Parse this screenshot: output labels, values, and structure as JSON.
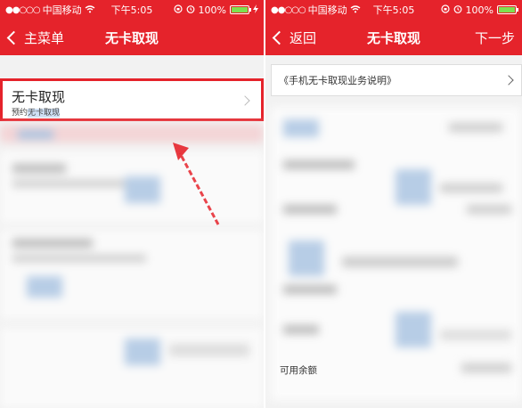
{
  "left_screen": {
    "status": {
      "carrier": "中国移动",
      "time": "下午5:05",
      "battery": "100%",
      "battery_fill": 1.0
    },
    "nav": {
      "back_label": "主菜单",
      "title": "无卡取现"
    },
    "main_item": {
      "title": "无卡取现",
      "subtitle_prefix": "预约",
      "subtitle_highlight": "无卡取现"
    },
    "accent_color": "#e5232b"
  },
  "right_screen": {
    "status": {
      "carrier": "中国移动",
      "time": "下午5:05",
      "battery": "100%",
      "battery_fill": 1.0
    },
    "nav": {
      "back_label": "返回",
      "title": "无卡取现",
      "next_label": "下一步"
    },
    "info_row_label": "《手机无卡取现业务说明》",
    "balance_label": "可用余额"
  }
}
